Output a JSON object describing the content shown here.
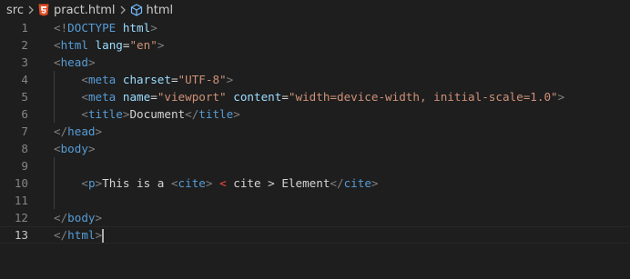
{
  "breadcrumb": {
    "folder": "src",
    "file": "pract.html",
    "symbol": "html",
    "file_icon": "html5-icon",
    "symbol_icon": "cube-icon"
  },
  "colors": {
    "background": "#1e1e1e",
    "tag": "#569cd6",
    "attribute": "#9cdcfe",
    "string": "#ce9178",
    "punctuation": "#808080",
    "text": "#d4d4d4",
    "error": "#f44747",
    "html5_icon": "#e44d26"
  },
  "editor": {
    "current_line": 13,
    "lines": [
      {
        "num": "1",
        "indent": "",
        "tokens": [
          {
            "t": "punct",
            "v": "<!"
          },
          {
            "t": "tag",
            "v": "DOCTYPE"
          },
          {
            "t": "text",
            "v": " "
          },
          {
            "t": "attr",
            "v": "html"
          },
          {
            "t": "punct",
            "v": ">"
          }
        ]
      },
      {
        "num": "2",
        "indent": "",
        "tokens": [
          {
            "t": "punct",
            "v": "<"
          },
          {
            "t": "tag",
            "v": "html"
          },
          {
            "t": "text",
            "v": " "
          },
          {
            "t": "attr",
            "v": "lang"
          },
          {
            "t": "text",
            "v": "="
          },
          {
            "t": "str",
            "v": "\"en\""
          },
          {
            "t": "punct",
            "v": ">"
          }
        ]
      },
      {
        "num": "3",
        "indent": "",
        "tokens": [
          {
            "t": "punct",
            "v": "<"
          },
          {
            "t": "tag",
            "v": "head"
          },
          {
            "t": "punct",
            "v": ">"
          }
        ]
      },
      {
        "num": "4",
        "indent": "    ",
        "tokens": [
          {
            "t": "punct",
            "v": "<"
          },
          {
            "t": "tag",
            "v": "meta"
          },
          {
            "t": "text",
            "v": " "
          },
          {
            "t": "attr",
            "v": "charset"
          },
          {
            "t": "text",
            "v": "="
          },
          {
            "t": "str",
            "v": "\"UTF-8\""
          },
          {
            "t": "punct",
            "v": ">"
          }
        ]
      },
      {
        "num": "5",
        "indent": "    ",
        "tokens": [
          {
            "t": "punct",
            "v": "<"
          },
          {
            "t": "tag",
            "v": "meta"
          },
          {
            "t": "text",
            "v": " "
          },
          {
            "t": "attr",
            "v": "name"
          },
          {
            "t": "text",
            "v": "="
          },
          {
            "t": "str",
            "v": "\"viewport\""
          },
          {
            "t": "text",
            "v": " "
          },
          {
            "t": "attr",
            "v": "content"
          },
          {
            "t": "text",
            "v": "="
          },
          {
            "t": "str",
            "v": "\"width=device-width, initial-scale=1.0\""
          },
          {
            "t": "punct",
            "v": ">"
          }
        ]
      },
      {
        "num": "6",
        "indent": "    ",
        "tokens": [
          {
            "t": "punct",
            "v": "<"
          },
          {
            "t": "tag",
            "v": "title"
          },
          {
            "t": "punct",
            "v": ">"
          },
          {
            "t": "text",
            "v": "Document"
          },
          {
            "t": "punct",
            "v": "</"
          },
          {
            "t": "tag",
            "v": "title"
          },
          {
            "t": "punct",
            "v": ">"
          }
        ]
      },
      {
        "num": "7",
        "indent": "",
        "tokens": [
          {
            "t": "punct",
            "v": "</"
          },
          {
            "t": "tag",
            "v": "head"
          },
          {
            "t": "punct",
            "v": ">"
          }
        ]
      },
      {
        "num": "8",
        "indent": "",
        "tokens": [
          {
            "t": "punct",
            "v": "<"
          },
          {
            "t": "tag",
            "v": "body"
          },
          {
            "t": "punct",
            "v": ">"
          }
        ]
      },
      {
        "num": "9",
        "indent": "",
        "tokens": []
      },
      {
        "num": "10",
        "indent": "    ",
        "tokens": [
          {
            "t": "punct",
            "v": "<"
          },
          {
            "t": "tag",
            "v": "p"
          },
          {
            "t": "punct",
            "v": ">"
          },
          {
            "t": "text",
            "v": "This is a "
          },
          {
            "t": "punct",
            "v": "<"
          },
          {
            "t": "tag",
            "v": "cite"
          },
          {
            "t": "punct",
            "v": ">"
          },
          {
            "t": "text",
            "v": " "
          },
          {
            "t": "err",
            "v": "<"
          },
          {
            "t": "text",
            "v": " cite > Element"
          },
          {
            "t": "punct",
            "v": "</"
          },
          {
            "t": "tag",
            "v": "cite"
          },
          {
            "t": "punct",
            "v": ">"
          }
        ]
      },
      {
        "num": "11",
        "indent": "",
        "tokens": []
      },
      {
        "num": "12",
        "indent": "",
        "tokens": [
          {
            "t": "punct",
            "v": "</"
          },
          {
            "t": "tag",
            "v": "body"
          },
          {
            "t": "punct",
            "v": ">"
          }
        ]
      },
      {
        "num": "13",
        "indent": "",
        "tokens": [
          {
            "t": "punct",
            "v": "</"
          },
          {
            "t": "tag",
            "v": "html"
          },
          {
            "t": "punct",
            "v": ">"
          }
        ]
      }
    ]
  }
}
